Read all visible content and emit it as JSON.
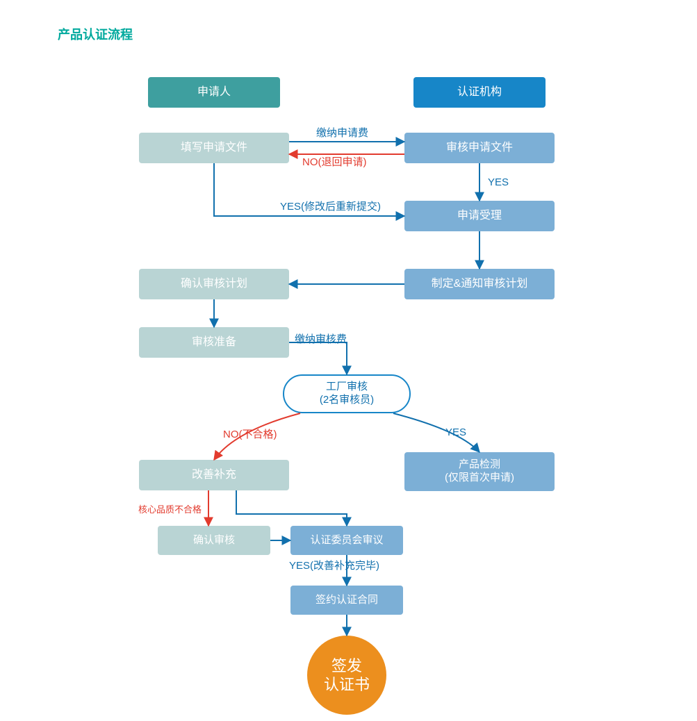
{
  "title": "产品认证流程",
  "colors": {
    "titleTeal": "#00A99D",
    "blue": "#1170AD",
    "red": "#E23B2E"
  },
  "headers": {
    "applicant": "申请人",
    "authority": "认证机构"
  },
  "applicant": {
    "fillDocs": "填写申请文件",
    "confirmPlan": "确认审核计划",
    "prepare": "审核准备",
    "improve": "改善补充",
    "confirmAudit": "确认审核"
  },
  "authority": {
    "reviewDocs": "审核申请文件",
    "accept": "申请受理",
    "makePlan": "制定&通知审核计划",
    "factoryAudit_l1": "工厂审核",
    "factoryAudit_l2": "(2名审核员)",
    "testing_l1": "产品检测",
    "testing_l2": "(仅限首次申请)",
    "committee": "认证委员会审议",
    "contract": "签约认证合同",
    "issue_l1": "签发",
    "issue_l2": "认证书"
  },
  "labels": {
    "payAppFee": "缴纳申请费",
    "noReturn": "NO(退回申请)",
    "yesPlain": "YES",
    "yesResubmit": "YES(修改后重新提交)",
    "payAuditFee": "缴纳审核费",
    "noFail": "NO(不合格)",
    "coreFail": "核心品质不合格",
    "yesImproved": "YES(改善补充完毕)"
  }
}
